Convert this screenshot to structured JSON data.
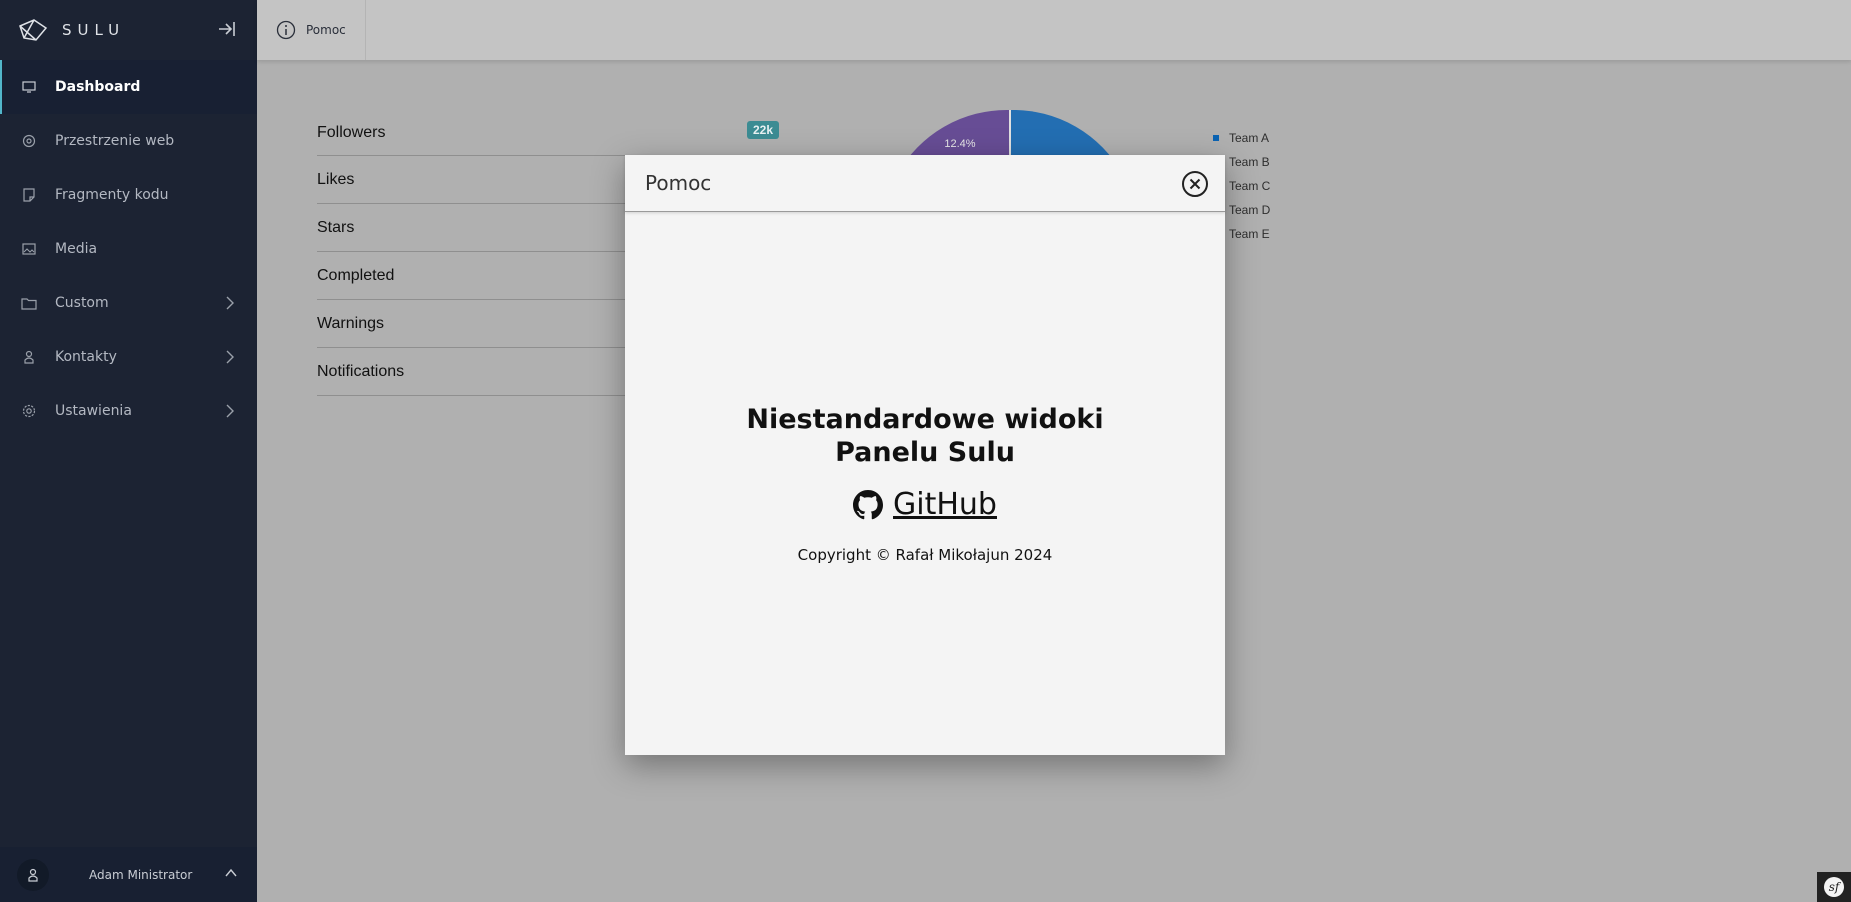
{
  "app": {
    "logo_text": "SULU"
  },
  "sidebar": {
    "items": [
      {
        "label": "Dashboard",
        "icon": "monitor-icon",
        "active": true
      },
      {
        "label": "Przestrzenie web",
        "icon": "globe-icon"
      },
      {
        "label": "Fragmenty kodu",
        "icon": "note-icon"
      },
      {
        "label": "Media",
        "icon": "image-icon"
      },
      {
        "label": "Custom",
        "icon": "folder-icon",
        "has_children": true
      },
      {
        "label": "Kontakty",
        "icon": "person-icon",
        "has_children": true
      },
      {
        "label": "Ustawienia",
        "icon": "gear-icon",
        "has_children": true
      }
    ],
    "user": {
      "name": "Adam Ministrator"
    }
  },
  "topbar": {
    "help_label": "Pomoc"
  },
  "dashboard": {
    "stats": [
      {
        "label": "Followers",
        "badge": "22k"
      },
      {
        "label": "Likes"
      },
      {
        "label": "Stars"
      },
      {
        "label": "Completed"
      },
      {
        "label": "Warnings"
      },
      {
        "label": "Notifications"
      }
    ]
  },
  "chart_data": {
    "type": "pie",
    "series": [
      {
        "name": "Team A",
        "color": "#0a63b3"
      },
      {
        "name": "Team B",
        "color": "#1a9e5c"
      },
      {
        "name": "Team C",
        "color": "#c9a227"
      },
      {
        "name": "Team D",
        "color": "#c0392b"
      },
      {
        "name": "Team E",
        "color": "#5b3c91"
      }
    ],
    "visible_labels": [
      "12.4%"
    ],
    "legend": "right"
  },
  "modal": {
    "title": "Pomoc",
    "heading": "Niestandardowe widoki Panelu Sulu",
    "link_label": "GitHub",
    "copyright": "Copyright © Rafał Mikołajun 2024"
  },
  "colors": {
    "sidebar_bg": "#1c2333",
    "accent": "#52b6ca",
    "overlay_bg": "#b0b0b0"
  }
}
